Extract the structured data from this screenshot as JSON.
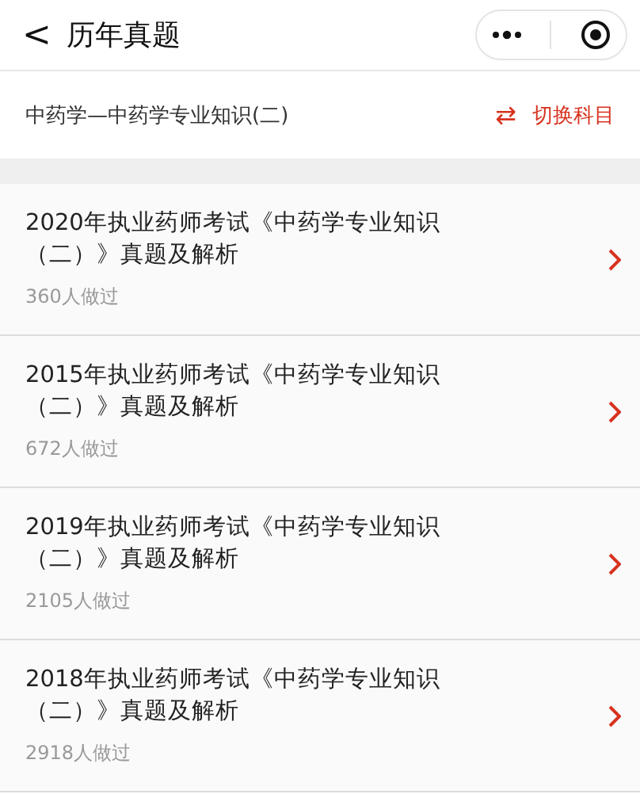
{
  "nav": {
    "back": "<",
    "title": "历年真题"
  },
  "subject": {
    "name": "中药学—中药学专业知识(二)",
    "switch_icon": "⇄",
    "switch_label": "切换科目"
  },
  "papers": [
    {
      "title": "2020年执业药师考试《中药学专业知识（二）》真题及解析",
      "count": "360人做过"
    },
    {
      "title": "2015年执业药师考试《中药学专业知识（二）》真题及解析",
      "count": "672人做过"
    },
    {
      "title": "2019年执业药师考试《中药学专业知识（二）》真题及解析",
      "count": "2105人做过"
    },
    {
      "title": "2018年执业药师考试《中药学专业知识（二）》真题及解析",
      "count": "2918人做过"
    }
  ]
}
